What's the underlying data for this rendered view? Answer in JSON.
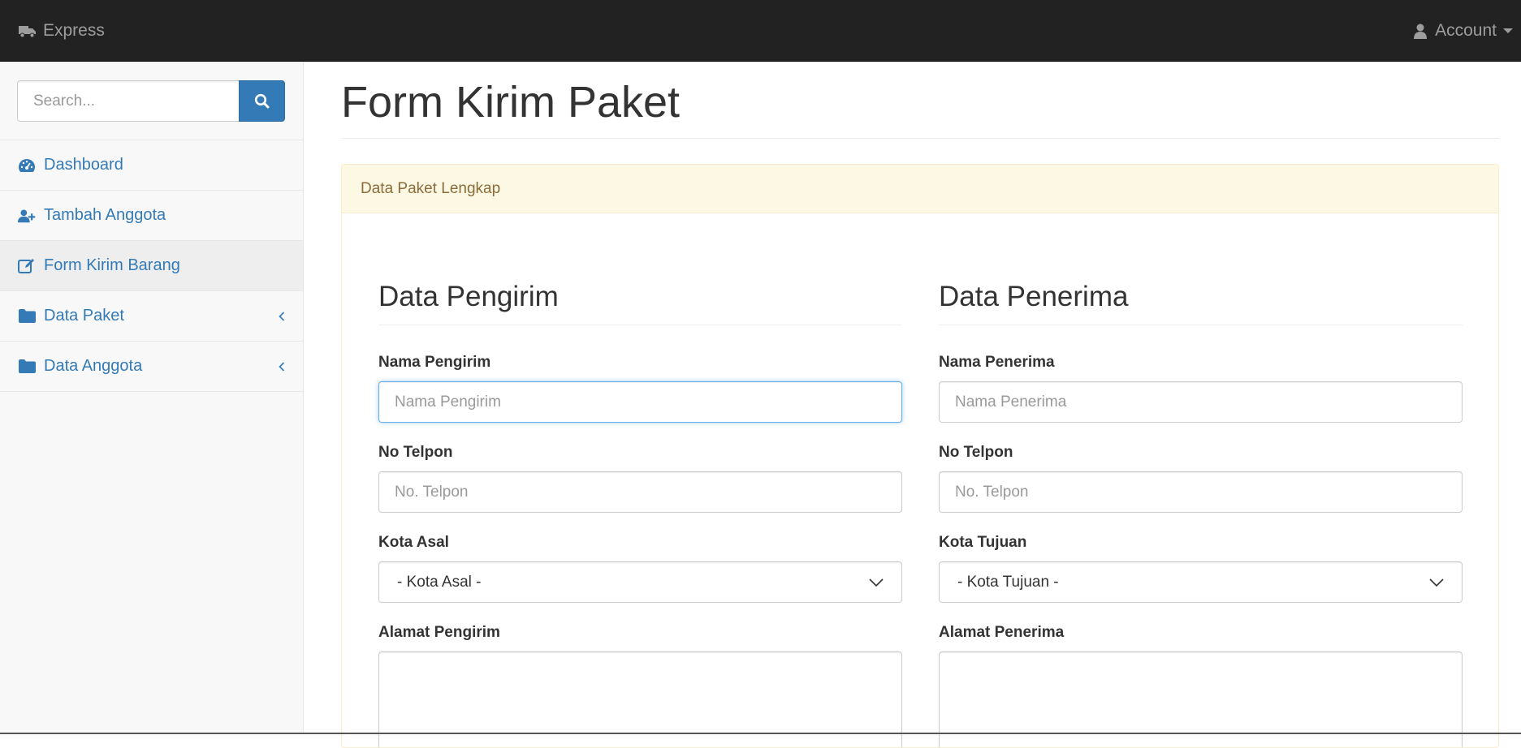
{
  "navbar": {
    "brand": "Express",
    "brand_icon": "truck-icon",
    "account_label": "Account",
    "account_icon": "user-icon"
  },
  "sidebar": {
    "search_placeholder": "Search...",
    "items": [
      {
        "label": "Dashboard",
        "icon": "dashboard-icon",
        "active": false
      },
      {
        "label": "Tambah Anggota",
        "icon": "user-plus-icon",
        "active": false
      },
      {
        "label": "Form Kirim Barang",
        "icon": "edit-icon",
        "active": true
      },
      {
        "label": "Data Paket",
        "icon": "folder-icon",
        "has_submenu": true
      },
      {
        "label": "Data Anggota",
        "icon": "folder-icon",
        "has_submenu": true
      }
    ]
  },
  "main": {
    "title": "Form Kirim Paket",
    "panel_heading": "Data Paket Lengkap",
    "sender": {
      "title": "Data Pengirim",
      "name_label": "Nama Pengirim",
      "name_placeholder": "Nama Pengirim",
      "phone_label": "No Telpon",
      "phone_placeholder": "No. Telpon",
      "city_label": "Kota Asal",
      "city_selected": "- Kota Asal -",
      "address_label": "Alamat Pengirim"
    },
    "receiver": {
      "title": "Data Penerima",
      "name_label": "Nama Penerima",
      "name_placeholder": "Nama Penerima",
      "phone_label": "No Telpon",
      "phone_placeholder": "No. Telpon",
      "city_label": "Kota Tujuan",
      "city_selected": "- Kota Tujuan -",
      "address_label": "Alamat Penerima"
    }
  },
  "colors": {
    "navbar_bg": "#222222",
    "link": "#337ab7",
    "panel_heading_bg": "#fcf8e3",
    "panel_heading_text": "#8a6d3b"
  }
}
